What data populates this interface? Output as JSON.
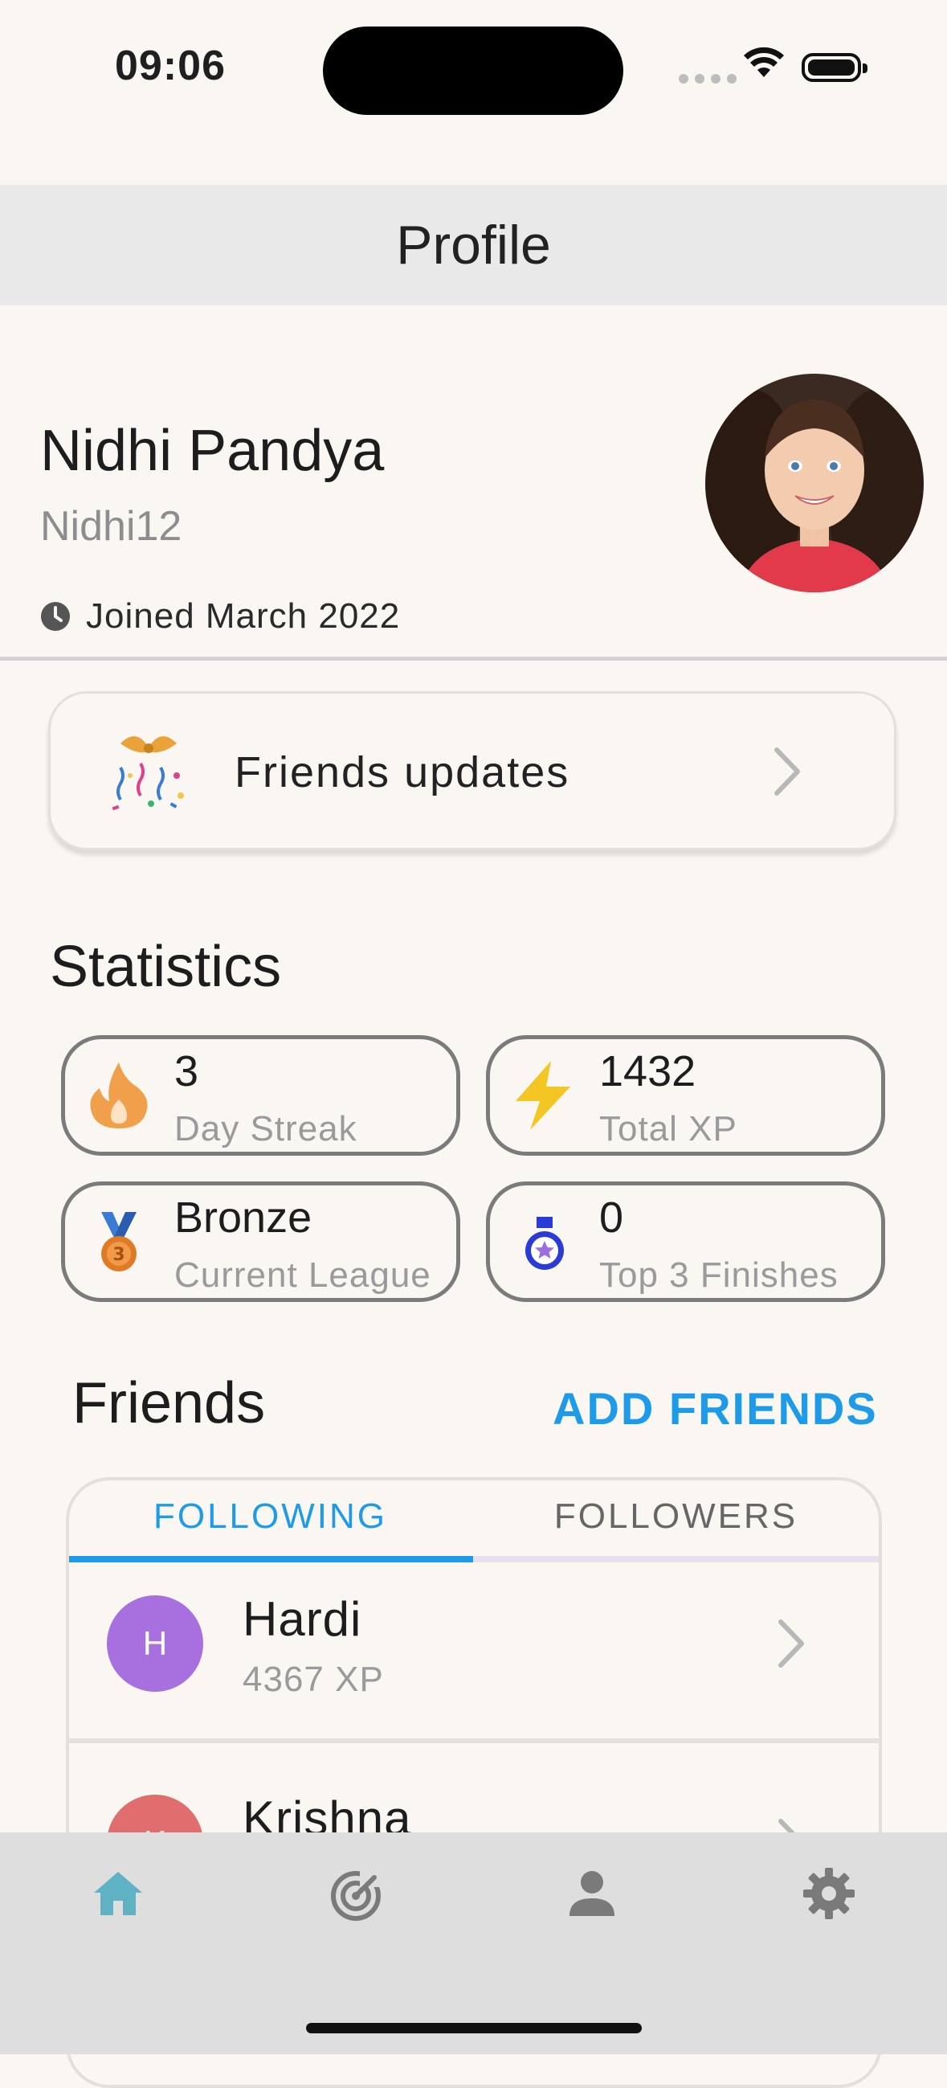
{
  "status_bar": {
    "time": "09:06"
  },
  "app_bar": {
    "title": "Profile"
  },
  "profile": {
    "name": "Nidhi Pandya",
    "username": "Nidhi12",
    "joined": "Joined March 2022"
  },
  "friends_updates": {
    "label": "Friends updates"
  },
  "statistics": {
    "title": "Statistics",
    "items": [
      {
        "value": "3",
        "label": "Day Streak",
        "icon": "fire-icon",
        "color": "#f0a04b"
      },
      {
        "value": "1432",
        "label": "Total XP",
        "icon": "lightning-icon",
        "color": "#f3c623"
      },
      {
        "value": "Bronze",
        "label": "Current League",
        "icon": "bronze-medal-icon",
        "color": "#e07b25"
      },
      {
        "value": "0",
        "label": "Top 3 Finishes",
        "icon": "star-medal-icon",
        "color": "#2a3bd6"
      }
    ]
  },
  "friends": {
    "title": "Friends",
    "add_label": "ADD FRIENDS",
    "tabs": [
      {
        "label": "FOLLOWING",
        "active": true
      },
      {
        "label": "FOLLOWERS",
        "active": false
      }
    ],
    "list": [
      {
        "initial": "H",
        "name": "Hardi",
        "xp": "4367 XP",
        "color": "#a870df"
      },
      {
        "initial": "K",
        "name": "Krishna",
        "xp": "",
        "color": "#e06e6e"
      }
    ]
  },
  "bottom_nav": {
    "items": [
      {
        "icon": "home-icon",
        "active": true
      },
      {
        "icon": "radar-icon",
        "active": false
      },
      {
        "icon": "person-icon",
        "active": false
      },
      {
        "icon": "gear-icon",
        "active": false
      }
    ]
  },
  "colors": {
    "accent": "#1e9be8",
    "background": "#faf6f2",
    "nav_active": "#5fb2c4",
    "nav_inactive": "#7a7a7a"
  }
}
